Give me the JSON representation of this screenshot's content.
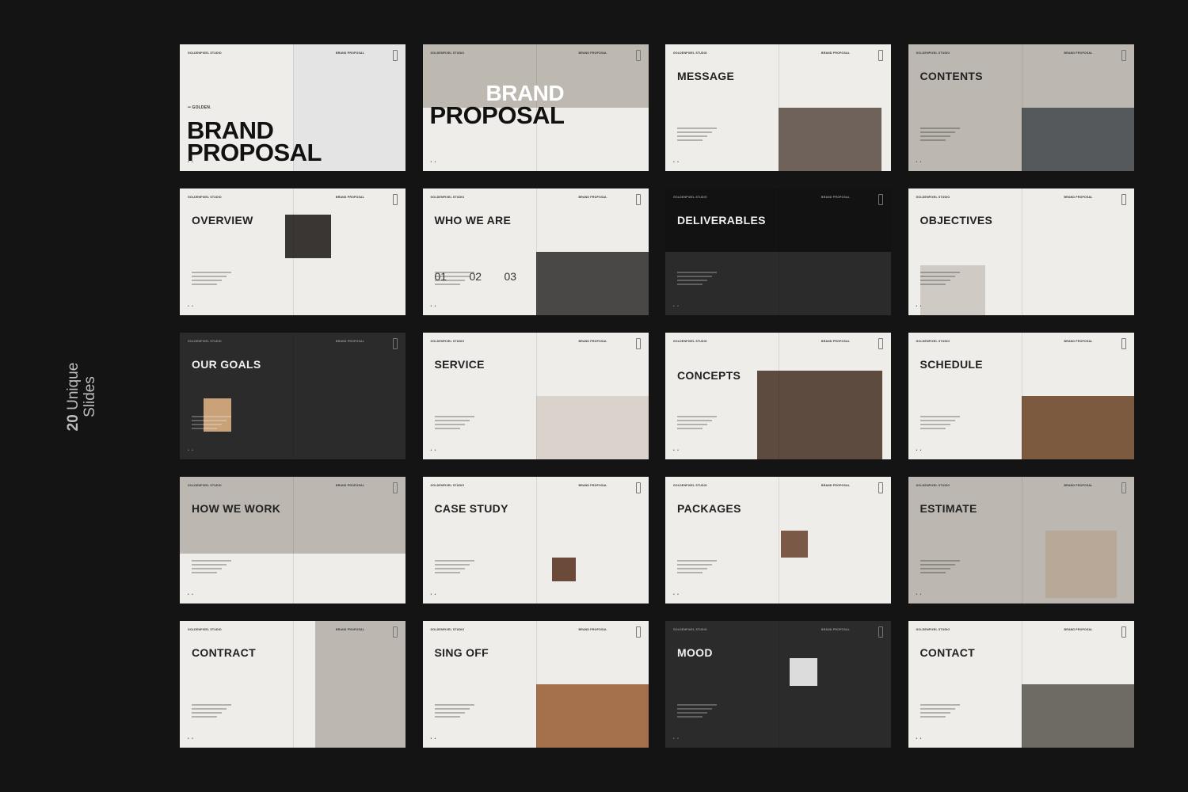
{
  "side_label": {
    "count": "20",
    "text": "Unique Slides"
  },
  "header": {
    "left": "GOLDENPIXEL STUDIO",
    "right": "BRAND PROPOSAL"
  },
  "colors": {
    "background": "#141414",
    "light_slide": "#efede9",
    "grey_slide": "#bcb8b1",
    "dark_slide": "#2b2b2b"
  },
  "slides": [
    {
      "title": "BRAND PROPOSAL",
      "theme": "light",
      "big": [
        "BRAND",
        "PROPOSAL"
      ],
      "tag": "•• GOLDEN."
    },
    {
      "title": "BRAND PROPOSAL",
      "theme": "light",
      "big": [
        "BRAND",
        "PROPOSAL"
      ]
    },
    {
      "title": "MESSAGE",
      "theme": "light"
    },
    {
      "title": "CONTENTS",
      "theme": "grey"
    },
    {
      "title": "OVERVIEW",
      "theme": "light"
    },
    {
      "title": "WHO WE ARE",
      "theme": "light",
      "numbers": [
        "01",
        "02",
        "03"
      ]
    },
    {
      "title": "DELIVERABLES",
      "theme": "dark"
    },
    {
      "title": "OBJECTIVES",
      "theme": "light"
    },
    {
      "title": "OUR GOALS",
      "theme": "dark"
    },
    {
      "title": "SERVICE",
      "theme": "light"
    },
    {
      "title": "CONCEPTS",
      "theme": "light"
    },
    {
      "title": "SCHEDULE",
      "theme": "light"
    },
    {
      "title": "HOW WE WORK",
      "theme": "light"
    },
    {
      "title": "CASE STUDY",
      "theme": "light"
    },
    {
      "title": "PACKAGES",
      "theme": "light"
    },
    {
      "title": "ESTIMATE",
      "theme": "grey"
    },
    {
      "title": "CONTRACT",
      "theme": "light"
    },
    {
      "title": "SING OFF",
      "theme": "light"
    },
    {
      "title": "MOOD",
      "theme": "dark"
    },
    {
      "title": "CONTACT",
      "theme": "light"
    }
  ]
}
